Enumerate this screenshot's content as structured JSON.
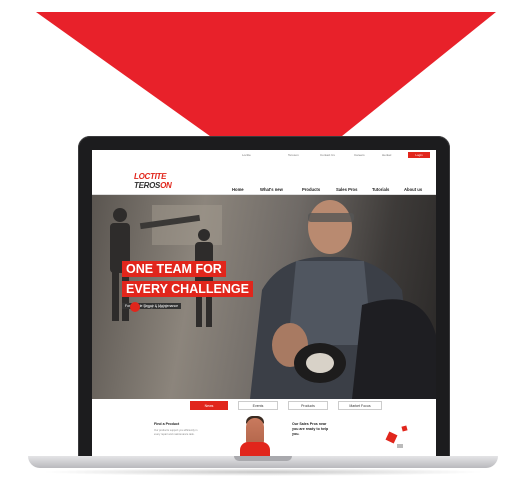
{
  "colors": {
    "accent": "#e1261c",
    "laptop_frame": "#1c1c1e"
  },
  "arrow": {
    "icon": "red-down-triangle",
    "color": "#e8212a"
  },
  "site": {
    "topbar": {
      "links": [
        "Loctite",
        "Teroson",
        "Contact Us",
        "Careers",
        "Henkel"
      ],
      "button": "Login"
    },
    "logo": {
      "line1": "LOCTITE",
      "line2a": "TEROS",
      "line2b": "ON"
    },
    "nav": [
      "Home",
      "What's new",
      "Products",
      "Sales Pros",
      "Tutorials",
      "About us"
    ],
    "hero": {
      "headline1": "ONE TEAM FOR",
      "headline2": "EVERY CHALLENGE",
      "subline": "For Vehicle Repair & Maintenance",
      "video_caption": "Play video"
    },
    "tabs": [
      "News",
      "Events",
      "Products",
      "Market Focus"
    ],
    "lower": {
      "left_title": "Find a Product",
      "left_text1": "Our products support you efficiently in",
      "left_text2": "every repair and maintenance task.",
      "mid_title1": "Our Sales Pros near",
      "mid_title2": "you are ready to help",
      "mid_title3": "you."
    }
  }
}
